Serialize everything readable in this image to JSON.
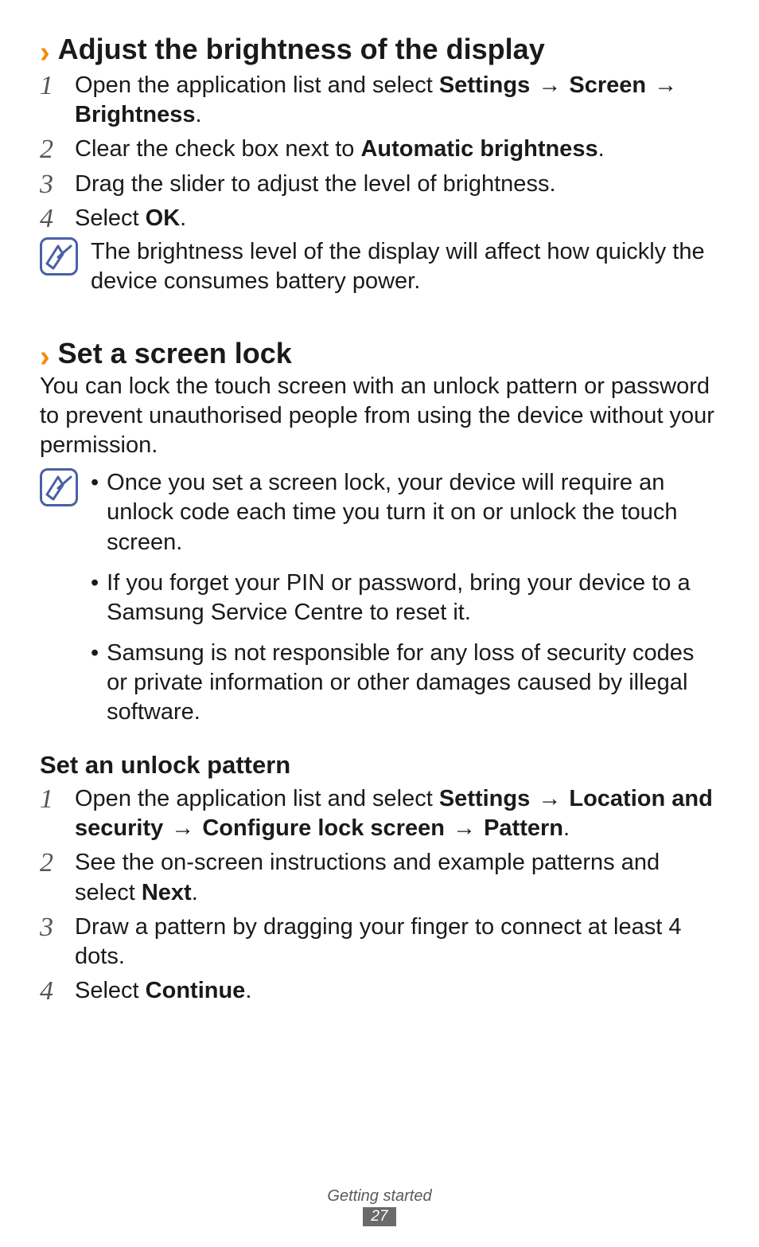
{
  "section1": {
    "title": "Adjust the brightness of the display",
    "steps": [
      {
        "n": "1",
        "parts": [
          "Open the application list and select ",
          "Settings",
          " → ",
          "Screen",
          " → ",
          "Brightness",
          "."
        ]
      },
      {
        "n": "2",
        "parts": [
          "Clear the check box next to ",
          "Automatic brightness",
          "."
        ]
      },
      {
        "n": "3",
        "parts": [
          "Drag the slider to adjust the level of brightness."
        ]
      },
      {
        "n": "4",
        "parts": [
          "Select ",
          "OK",
          "."
        ]
      }
    ],
    "note": "The brightness level of the display will affect how quickly the device consumes battery power."
  },
  "section2": {
    "title": "Set a screen lock",
    "intro": "You can lock the touch screen with an unlock pattern or password to prevent unauthorised people from using the device without your permission.",
    "note_bullets": [
      "Once you set a screen lock, your device will require an unlock code each time you turn it on or unlock the touch screen.",
      "If you forget your PIN or password, bring your device to a Samsung Service Centre to reset it.",
      "Samsung is not responsible for any loss of security codes or private information or other damages caused by illegal software."
    ]
  },
  "section3": {
    "title": "Set an unlock pattern",
    "steps": [
      {
        "n": "1",
        "parts": [
          "Open the application list and select ",
          "Settings",
          " → ",
          "Location and security",
          " → ",
          "Configure lock screen",
          " → ",
          "Pattern",
          "."
        ]
      },
      {
        "n": "2",
        "parts": [
          "See the on-screen instructions and example patterns and select ",
          "Next",
          "."
        ]
      },
      {
        "n": "3",
        "parts": [
          "Draw a pattern by dragging your finger to connect at least 4 dots."
        ]
      },
      {
        "n": "4",
        "parts": [
          "Select ",
          "Continue",
          "."
        ]
      }
    ]
  },
  "footer": {
    "section_name": "Getting started",
    "page": "27"
  },
  "bold_indices": {
    "s1_0": [
      1,
      3,
      5
    ],
    "s1_1": [
      1
    ],
    "s1_2": [],
    "s1_3": [
      1
    ],
    "s3_0": [
      1,
      3,
      5,
      7
    ],
    "s3_1": [
      1
    ],
    "s3_2": [],
    "s3_3": [
      1
    ]
  }
}
